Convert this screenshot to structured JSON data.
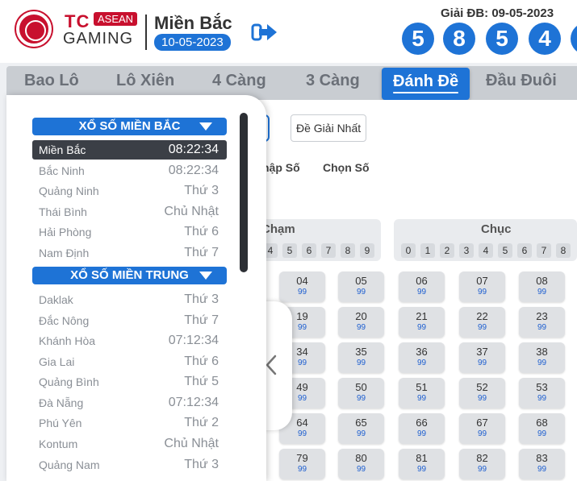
{
  "brand": {
    "tc": "TC",
    "asean": "ASEAN",
    "gaming": "GAMING"
  },
  "region": {
    "name": "Miền Bắc",
    "date": "10-05-2023"
  },
  "icons": {
    "logo": "chip-logo",
    "switch": "arrow-right-icon",
    "collapse": "chevron-left-icon"
  },
  "colors": {
    "accent": "#1e73d6",
    "brand": "#c8102e",
    "odds": "#1e5fd0"
  },
  "result": {
    "label": "Giải ĐB: 09-05-2023",
    "digits": [
      "5",
      "8",
      "5",
      "4"
    ]
  },
  "tabs": [
    "Bao Lô",
    "Lô Xiên",
    "4 Càng",
    "3 Càng",
    "Đánh Đề",
    "Đầu Đuôi"
  ],
  "active_tab": "Đánh Đề",
  "subtabs": {
    "giai_nhat": "Đề Giải Nhất"
  },
  "modes": {
    "nhap": "hập Số",
    "chon": "Chọn Số"
  },
  "groups": {
    "cham": {
      "title": "Chạm",
      "digits": [
        "4",
        "5",
        "6",
        "7",
        "8",
        "9"
      ]
    },
    "chuc": {
      "title": "Chục",
      "digits": [
        "0",
        "1",
        "2",
        "3",
        "4",
        "5",
        "6",
        "7",
        "8"
      ]
    }
  },
  "grid": [
    [
      {
        "n": "04",
        "o": "99"
      },
      {
        "n": "05",
        "o": "99"
      },
      {
        "n": "06",
        "o": "99"
      },
      {
        "n": "07",
        "o": "99"
      },
      {
        "n": "08",
        "o": "99"
      }
    ],
    [
      {
        "n": "19",
        "o": "99"
      },
      {
        "n": "20",
        "o": "99"
      },
      {
        "n": "21",
        "o": "99"
      },
      {
        "n": "22",
        "o": "99"
      },
      {
        "n": "23",
        "o": "99"
      }
    ],
    [
      {
        "n": "34",
        "o": "99"
      },
      {
        "n": "35",
        "o": "99"
      },
      {
        "n": "36",
        "o": "99"
      },
      {
        "n": "37",
        "o": "99"
      },
      {
        "n": "38",
        "o": "99"
      }
    ],
    [
      {
        "n": "49",
        "o": "99"
      },
      {
        "n": "50",
        "o": "99"
      },
      {
        "n": "51",
        "o": "99"
      },
      {
        "n": "52",
        "o": "99"
      },
      {
        "n": "53",
        "o": "99"
      }
    ],
    [
      {
        "n": "64",
        "o": "99"
      },
      {
        "n": "65",
        "o": "99"
      },
      {
        "n": "66",
        "o": "99"
      },
      {
        "n": "67",
        "o": "99"
      },
      {
        "n": "68",
        "o": "99"
      }
    ],
    [
      {
        "n": "79",
        "o": "99"
      },
      {
        "n": "80",
        "o": "99"
      },
      {
        "n": "81",
        "o": "99"
      },
      {
        "n": "82",
        "o": "99"
      },
      {
        "n": "83",
        "o": "99"
      }
    ]
  ],
  "sidebar": {
    "sections": [
      {
        "title": "XỔ SỐ MIỀN BẮC",
        "items": [
          {
            "name": "Miền Bắc",
            "time": "08:22:34",
            "active": true
          },
          {
            "name": "Bắc Ninh",
            "time": "08:22:34"
          },
          {
            "name": "Quảng Ninh",
            "time": "Thứ 3"
          },
          {
            "name": "Thái Bình",
            "time": "Chủ Nhật"
          },
          {
            "name": "Hải Phòng",
            "time": "Thứ 6"
          },
          {
            "name": "Nam Định",
            "time": "Thứ 7"
          }
        ]
      },
      {
        "title": "XỔ SỐ MIỀN TRUNG",
        "items": [
          {
            "name": "Daklak",
            "time": "Thứ 3"
          },
          {
            "name": "Đắc Nông",
            "time": "Thứ 7"
          },
          {
            "name": "Khánh Hòa",
            "time": "07:12:34"
          },
          {
            "name": "Gia Lai",
            "time": "Thứ 6"
          },
          {
            "name": "Quảng Bình",
            "time": "Thứ 5"
          },
          {
            "name": "Đà Nẵng",
            "time": "07:12:34"
          },
          {
            "name": "Phú Yên",
            "time": "Thứ 2"
          },
          {
            "name": "Kontum",
            "time": "Chủ Nhật"
          },
          {
            "name": "Quảng Nam",
            "time": "Thứ 3"
          }
        ]
      }
    ]
  }
}
